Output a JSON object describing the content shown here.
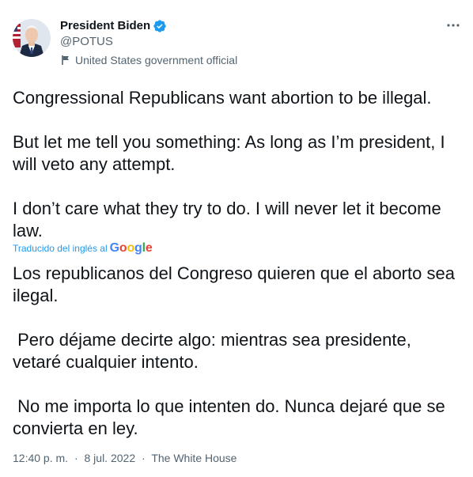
{
  "author": {
    "display_name": "President Biden",
    "handle": "@POTUS",
    "affiliation": "United States government official",
    "verified": true
  },
  "tweet": {
    "original_text": "Congressional Republicans want abortion to be illegal.\n\nBut let me tell you something: As long as I’m president, I will veto any attempt.\n\nI don’t care what they try to do. I will never let it become law.",
    "translation_label": "Traducido del inglés al",
    "translation_provider": "Google",
    "translated_text": "Los republicanos del Congreso quieren que el aborto sea ilegal.\n\n Pero déjame decirte algo: mientras sea presidente, vetaré cualquier intento.\n\n No me importa lo que intenten do. Nunca dejaré que se convierta en ley.",
    "time": "12:40 p. m.",
    "date": "8 jul. 2022",
    "source": "The White House",
    "separator": "·"
  },
  "icons": {
    "verified": "verified-badge-icon",
    "affiliation": "flag-icon",
    "more": "more-dots-icon"
  },
  "colors": {
    "primary_text": "#0f1419",
    "secondary_text": "#536471",
    "accent": "#1d9bf0"
  }
}
